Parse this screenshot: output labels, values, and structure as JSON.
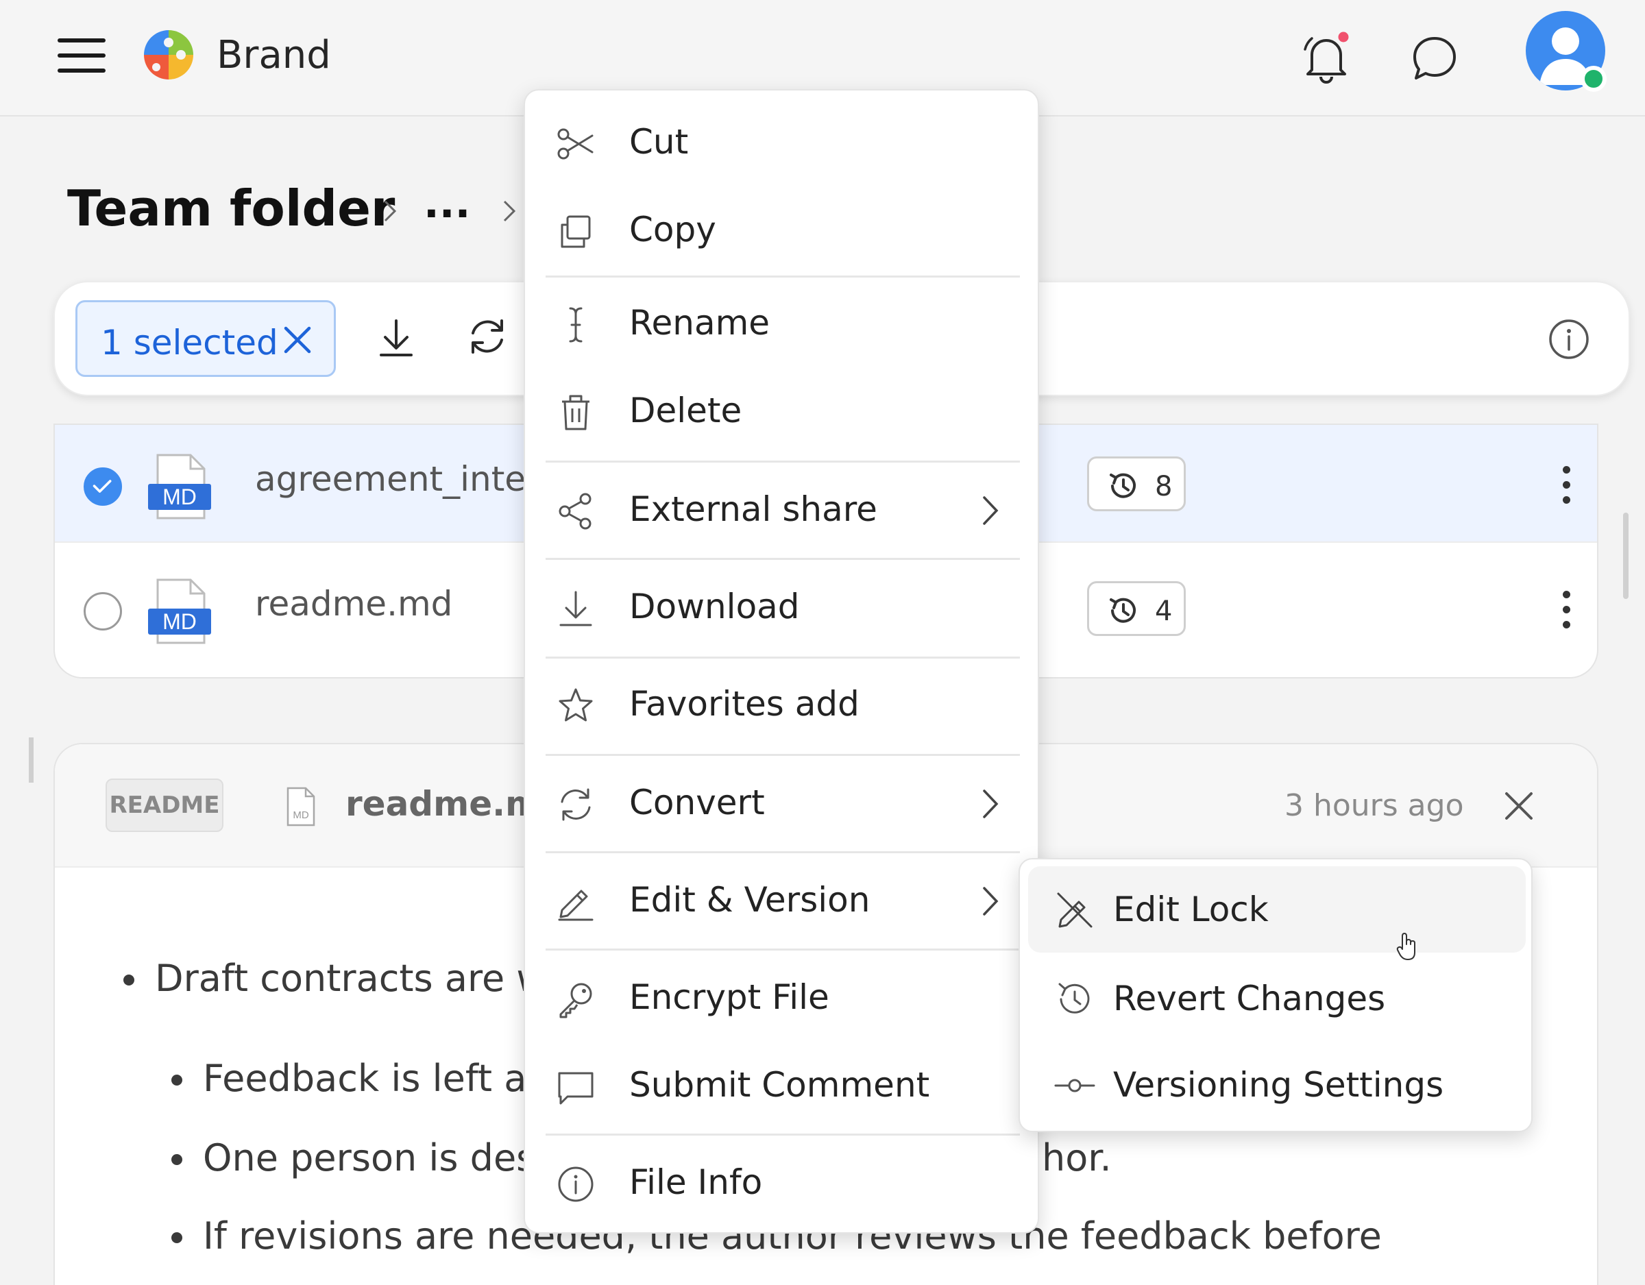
{
  "header": {
    "brand": "Brand",
    "menu_icon": "hamburger-menu-icon",
    "notification_icon": "bell-icon",
    "chat_icon": "chat-bubble-icon",
    "avatar_icon": "user-avatar-icon",
    "notification_dot_color": "#f0516d",
    "online_status_color": "#1fb36b"
  },
  "breadcrumb": {
    "title": "Team folder",
    "ellipsis": "..."
  },
  "toolbar": {
    "selected_label": "1 selected",
    "accent_color": "#1d63d9"
  },
  "files": [
    {
      "name": "agreement_intern",
      "type_label": "MD",
      "versions": "8",
      "selected": true
    },
    {
      "name": "readme.md",
      "type_label": "MD",
      "versions": "4",
      "selected": false
    }
  ],
  "readme": {
    "tag": "README",
    "file_icon_label": "MD",
    "filename": "readme.md",
    "timestamp": "3 hours ago",
    "bullets": [
      "Draft contracts are w",
      "Feedback is left as",
      "One person is des",
      "hor.",
      "If revisions are needed, the author reviews the feedback before"
    ]
  },
  "context_menu": {
    "items": [
      {
        "label": "Cut",
        "icon": "scissors-icon"
      },
      {
        "label": "Copy",
        "icon": "copy-icon"
      },
      {
        "label": "Rename",
        "icon": "text-cursor-icon"
      },
      {
        "label": "Delete",
        "icon": "trash-icon"
      },
      {
        "label": "External share",
        "icon": "share-icon",
        "submenu": true
      },
      {
        "label": "Download",
        "icon": "download-icon"
      },
      {
        "label": "Favorites add",
        "icon": "star-icon"
      },
      {
        "label": "Convert",
        "icon": "convert-icon",
        "submenu": true
      },
      {
        "label": "Edit & Version",
        "icon": "pencil-icon",
        "submenu": true
      },
      {
        "label": "Encrypt File",
        "icon": "key-icon"
      },
      {
        "label": "Submit Comment",
        "icon": "comment-icon"
      },
      {
        "label": "File Info",
        "icon": "info-icon"
      }
    ]
  },
  "submenu": {
    "items": [
      {
        "label": "Edit Lock",
        "icon": "edit-lock-icon",
        "hovered": true
      },
      {
        "label": "Revert Changes",
        "icon": "history-icon"
      },
      {
        "label": "Versioning Settings",
        "icon": "version-commit-icon"
      }
    ]
  }
}
